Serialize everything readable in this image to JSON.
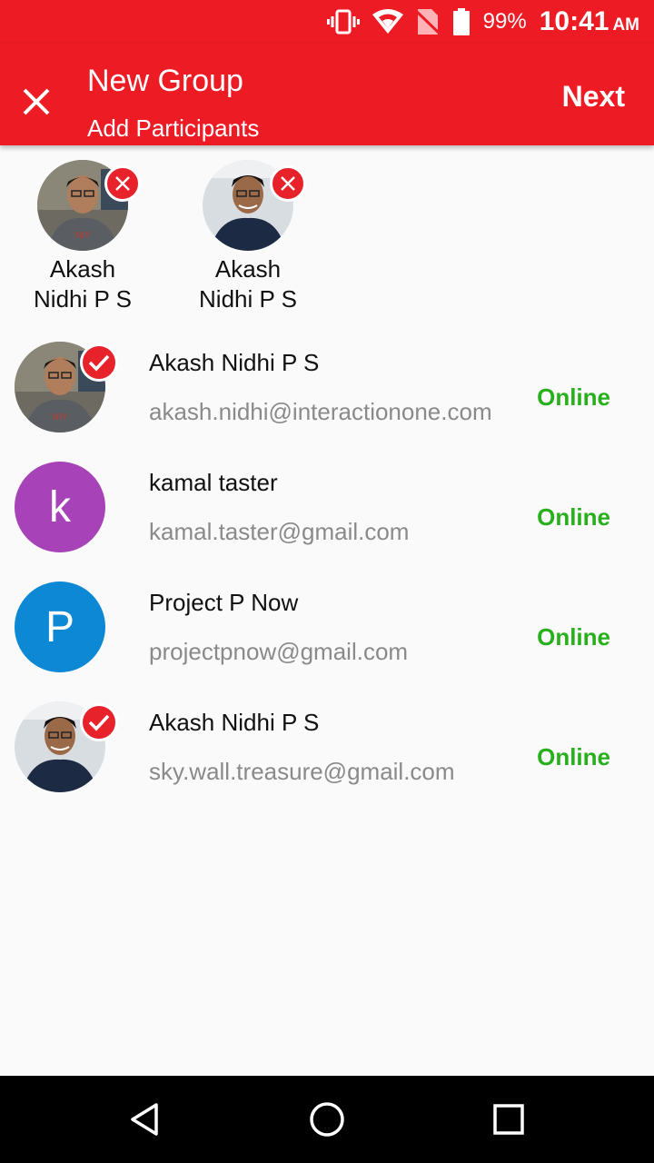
{
  "status_bar": {
    "battery_percent": "99%",
    "time": "10:41",
    "ampm": "AM",
    "icons": [
      "vibrate-icon",
      "wifi-icon",
      "no-sim-icon",
      "battery-icon"
    ]
  },
  "app_bar": {
    "title": "New Group",
    "subtitle": "Add Participants",
    "next_label": "Next",
    "close_icon": "close-icon"
  },
  "selected_participants": [
    {
      "name_line1": "Akash",
      "name_line2": "Nidhi P S"
    },
    {
      "name_line1": "Akash",
      "name_line2": "Nidhi P S"
    }
  ],
  "contacts": [
    {
      "name": "Akash Nidhi P S",
      "email": "akash.nidhi@interactionone.com",
      "status": "Online",
      "selected": true
    },
    {
      "name": "kamal taster",
      "email": "kamal.taster@gmail.com",
      "status": "Online",
      "selected": false,
      "initial": "k",
      "color": "#a842b8"
    },
    {
      "name": "Project P Now",
      "email": "projectpnow@gmail.com",
      "status": "Online",
      "selected": false,
      "initial": "P",
      "color": "#0c88d4"
    },
    {
      "name": "Akash Nidhi P S",
      "email": "sky.wall.treasure@gmail.com",
      "status": "Online",
      "selected": true
    }
  ],
  "colors": {
    "accent": "#ec1b24",
    "online": "#28b01c"
  },
  "nav_bar": {
    "icons": [
      "back-icon",
      "home-icon",
      "recents-icon"
    ]
  }
}
